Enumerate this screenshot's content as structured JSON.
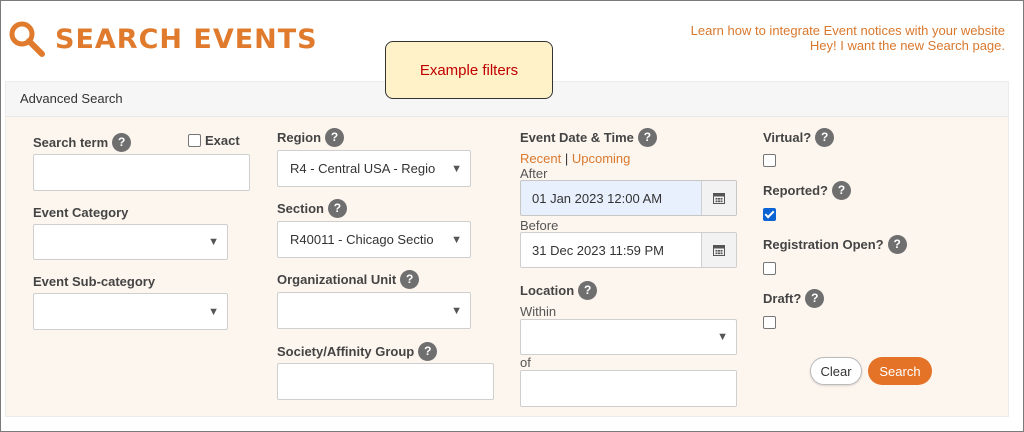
{
  "header": {
    "title": "SEARCH EVENTS",
    "links": [
      "Learn how to integrate Event notices with your website",
      "Hey! I want the new Search page."
    ]
  },
  "callout": {
    "text": "Example filters"
  },
  "panel": {
    "title": "Advanced Search",
    "col1": {
      "search_term_label": "Search term",
      "exact_label": "Exact",
      "search_term_value": "",
      "event_category_label": "Event Category",
      "event_category_value": "",
      "event_subcategory_label": "Event Sub-category",
      "event_subcategory_value": ""
    },
    "col2": {
      "region_label": "Region",
      "region_value": "R4 - Central USA - Regio",
      "section_label": "Section",
      "section_value": "R40011 - Chicago Sectio",
      "org_unit_label": "Organizational Unit",
      "org_unit_value": "",
      "society_label": "Society/Affinity Group",
      "society_value": ""
    },
    "col3": {
      "date_label": "Event Date & Time",
      "recent": "Recent",
      "separator": "|",
      "upcoming": "Upcoming",
      "after_label": "After",
      "after_value": "01 Jan 2023 12:00 AM",
      "before_label": "Before",
      "before_value": "31 Dec 2023 11:59 PM",
      "location_label": "Location",
      "within_label": "Within",
      "within_value": "",
      "of_label": "of",
      "of_value": ""
    },
    "col4": {
      "virtual_label": "Virtual?",
      "virtual_checked": false,
      "reported_label": "Reported?",
      "reported_checked": true,
      "registration_label": "Registration Open?",
      "registration_checked": false,
      "draft_label": "Draft?",
      "draft_checked": false
    },
    "buttons": {
      "clear": "Clear",
      "search": "Search"
    }
  },
  "help_glyph": "?",
  "colors": {
    "accent": "#e07b2e",
    "button": "#e47327",
    "callout_bg": "#fff2c9",
    "callout_text": "#c00000",
    "panel_bg": "#fdf6ef"
  },
  "icons": [
    "search-icon",
    "help-icon",
    "calendar-icon",
    "chevron-down-icon"
  ]
}
